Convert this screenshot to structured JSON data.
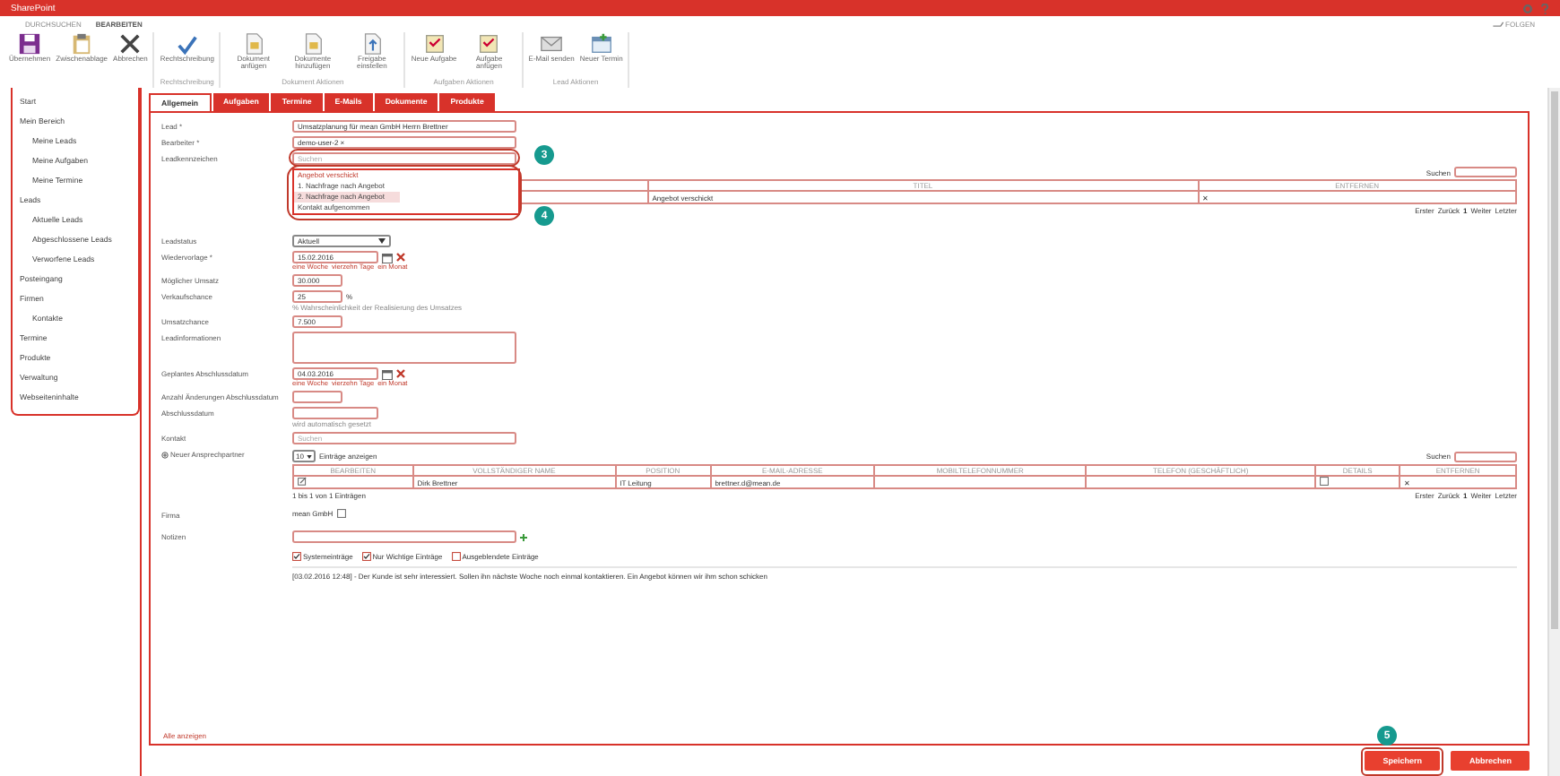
{
  "app": {
    "title": "SharePoint",
    "follow": "FOLGEN"
  },
  "ribbon": {
    "tabs": [
      {
        "label": "DURCHSUCHEN",
        "selected": false
      },
      {
        "label": "BEARBEITEN",
        "selected": true
      }
    ],
    "groups": [
      {
        "buttons": [
          {
            "label": "Übernehmen"
          },
          {
            "label": "Zwischenablage"
          },
          {
            "label": "Abbrechen"
          }
        ]
      },
      {
        "label": "Rechtschreibung",
        "buttons": [
          {
            "label": "Rechtschreibung"
          }
        ]
      },
      {
        "label": "Dokument Aktionen",
        "buttons": [
          {
            "label": "Dokument anfügen"
          },
          {
            "label": "Dokumente hinzufügen"
          },
          {
            "label": "Freigabe einstellen"
          }
        ]
      },
      {
        "label": "Aufgaben Aktionen",
        "buttons": [
          {
            "label": "Neue Aufgabe"
          },
          {
            "label": "Aufgabe anfügen"
          }
        ]
      },
      {
        "label": "Lead Aktionen",
        "buttons": [
          {
            "label": "E-Mail senden"
          },
          {
            "label": "Neuer Termin"
          }
        ]
      }
    ]
  },
  "sidebar": {
    "items": [
      {
        "label": "Start"
      },
      {
        "label": "Mein Bereich",
        "children": [
          {
            "label": "Meine Leads"
          },
          {
            "label": "Meine Aufgaben"
          },
          {
            "label": "Meine Termine"
          }
        ]
      },
      {
        "label": "Leads",
        "children": [
          {
            "label": "Aktuelle Leads"
          },
          {
            "label": "Abgeschlossene Leads"
          },
          {
            "label": "Verworfene Leads"
          }
        ]
      },
      {
        "label": "Posteingang"
      },
      {
        "label": "Firmen",
        "children": [
          {
            "label": "Kontakte"
          }
        ]
      },
      {
        "label": "Termine"
      },
      {
        "label": "Produkte"
      },
      {
        "label": "Verwaltung"
      },
      {
        "label": "Webseiteninhalte"
      }
    ]
  },
  "tabs": [
    {
      "label": "Allgemein",
      "selected": true
    },
    {
      "label": "Aufgaben",
      "selected": false
    },
    {
      "label": "Termine",
      "selected": false
    },
    {
      "label": "E-Mails",
      "selected": false
    },
    {
      "label": "Dokumente",
      "selected": false
    },
    {
      "label": "Produkte",
      "selected": false
    }
  ],
  "fields": [
    {
      "kind": "text",
      "label": "Lead *",
      "value": "Umsatzplanung für mean GmbH Herrn Brettner"
    },
    {
      "kind": "text",
      "label": "Bearbeiter *",
      "value": "demo-user-2 ×"
    },
    {
      "kind": "lookup",
      "label": "Leadkennzeichen",
      "placeholder": "Suchen",
      "options": [
        {
          "label": "Angebot verschickt",
          "selected": false
        },
        {
          "label": "1. Nachfrage nach Angebot",
          "selected": false
        },
        {
          "label": "2. Nachfrage nach Angebot",
          "selected": true
        },
        {
          "label": "Kontakt aufgenommen",
          "selected": false
        }
      ],
      "table": {
        "search_label": "Suchen",
        "columns": [
          "TITEL",
          "ENTFERNEN"
        ],
        "rows": [
          {
            "title": "Angebot verschickt",
            "remove": "✕"
          }
        ],
        "pagination": [
          "Erster",
          "Zurück",
          "1",
          "Weiter",
          "Letzter"
        ]
      }
    },
    {
      "kind": "select",
      "label": "Leadstatus",
      "value": "Aktuell"
    },
    {
      "kind": "date",
      "label": "Wiedervorlage *",
      "value": "15.02.2016",
      "links": [
        "eine Woche",
        "vierzehn Tage",
        "ein Monat"
      ]
    },
    {
      "kind": "number",
      "label": "Möglicher Umsatz",
      "value": "30.000"
    },
    {
      "kind": "number",
      "label": "Verkaufschance",
      "value": "25",
      "unit": "%",
      "hint": "% Wahrscheinlichkeit der Realisierung des Umsatzes"
    },
    {
      "kind": "number",
      "label": "Umsatzchance",
      "value": "7.500"
    },
    {
      "kind": "textarea",
      "label": "Leadinformationen"
    },
    {
      "kind": "date",
      "label": "Geplantes Abschlussdatum",
      "value": "04.03.2016",
      "links": [
        "eine Woche",
        "vierzehn Tage",
        "ein Monat"
      ]
    },
    {
      "kind": "number",
      "label": "Anzahl Änderungen Abschlussdatum"
    },
    {
      "kind": "plaindate",
      "label": "Abschlussdatum",
      "hint": "wird automatisch gesetzt"
    },
    {
      "kind": "search",
      "label": "Kontakt",
      "placeholder": "Suchen"
    }
  ],
  "contacts": {
    "add_label": "Neuer Ansprechpartner",
    "page_size": "10",
    "show_label": "Einträge anzeigen",
    "search_label": "Suchen",
    "columns": [
      "BEARBEITEN",
      "VOLLSTÄNDIGER NAME",
      "POSITION",
      "E-MAIL-ADRESSE",
      "MOBILTELEFONNUMMER",
      "TELEFON (GESCHÄFTLICH)",
      "DETAILS",
      "ENTFERNEN"
    ],
    "rows": [
      {
        "name": "Dirk Brettner",
        "position": "IT Leitung",
        "email": "brettner.d@mean.de",
        "remove": "✕"
      }
    ],
    "info": "1 bis 1 von 1 Einträgen",
    "pagination": [
      "Erster",
      "Zurück",
      "1",
      "Weiter",
      "Letzter"
    ]
  },
  "company": {
    "label": "Firma",
    "value": "mean GmbH"
  },
  "notes": {
    "label": "Notizen",
    "filters": [
      {
        "label": "Systemeinträge",
        "checked": true
      },
      {
        "label": "Nur Wichtige Einträge",
        "checked": true
      },
      {
        "label": "Ausgeblendete Einträge",
        "checked": false
      }
    ],
    "entries": [
      "[03.02.2016 12:48] - Der Kunde ist sehr interessiert. Sollen ihn nächste Woche noch einmal kontaktieren. Ein Angebot können wir ihm schon schicken"
    ],
    "show_all": "Alle anzeigen"
  },
  "buttons": [
    {
      "label": "Speichern",
      "highlighted": true
    },
    {
      "label": "Abbrechen",
      "highlighted": false
    }
  ],
  "callouts": [
    "3",
    "4",
    "5"
  ]
}
